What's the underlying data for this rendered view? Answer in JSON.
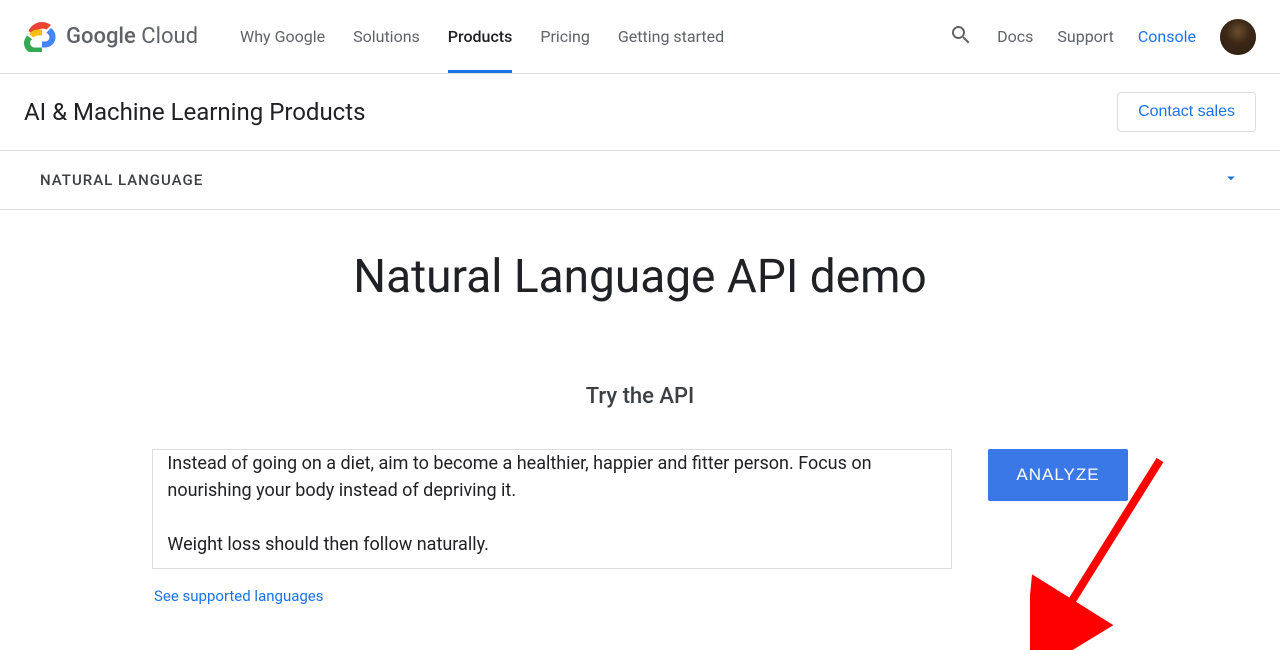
{
  "header": {
    "brand_google": "Google",
    "brand_cloud": " Cloud",
    "nav": {
      "why": "Why Google",
      "solutions": "Solutions",
      "products": "Products",
      "pricing": "Pricing",
      "getting_started": "Getting started"
    },
    "docs": "Docs",
    "support": "Support",
    "console": "Console"
  },
  "subheader": {
    "title": "AI & Machine Learning Products",
    "contact_sales": "Contact sales"
  },
  "expander": {
    "title": "NATURAL LANGUAGE"
  },
  "main": {
    "title": "Natural Language API demo",
    "try_label": "Try the API",
    "textarea_value": "Instead of going on a diet, aim to become a healthier, happier and fitter person. Focus on nourishing your body instead of depriving it.\n\nWeight loss should then follow naturally.",
    "analyze_label": "ANALYZE",
    "supported_link": "See supported languages"
  }
}
